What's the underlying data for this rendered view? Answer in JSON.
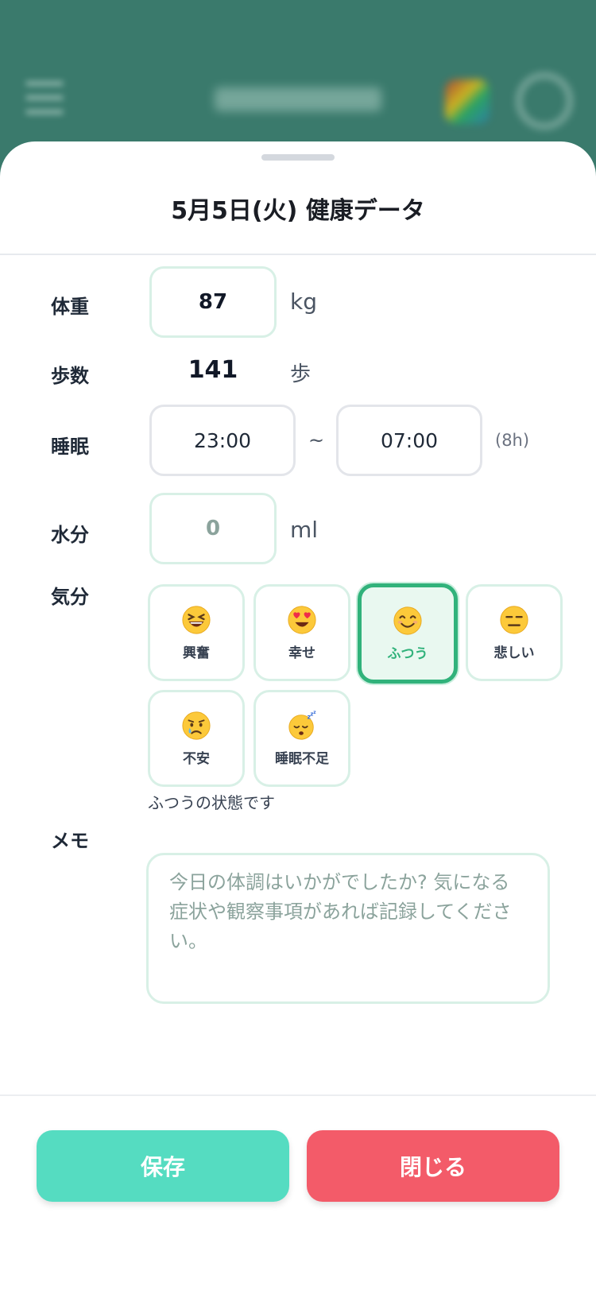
{
  "colors": {
    "accent_green": "#31b27b",
    "save_button": "#55dcc1",
    "close_button": "#f35b69",
    "header_bg": "#3a7a6c"
  },
  "sheet": {
    "title": "5月5日(火) 健康データ"
  },
  "form": {
    "weight": {
      "label": "体重",
      "value": "87",
      "unit": "kg"
    },
    "steps": {
      "label": "歩数",
      "value": "141",
      "unit": "歩"
    },
    "sleep": {
      "label": "睡眠",
      "start": "23:00",
      "separator": "~",
      "end": "07:00",
      "duration": "(8h)"
    },
    "water": {
      "label": "水分",
      "value": "0",
      "unit": "ml"
    },
    "mood": {
      "label": "気分",
      "options": [
        {
          "label": "興奮",
          "icon": "grinning-squint-icon"
        },
        {
          "label": "幸せ",
          "icon": "heart-eyes-icon"
        },
        {
          "label": "ふつう",
          "icon": "smiling-face-icon",
          "selected": true
        },
        {
          "label": "悲しい",
          "icon": "expressionless-icon"
        },
        {
          "label": "不安",
          "icon": "crying-face-icon"
        },
        {
          "label": "睡眠不足",
          "icon": "sleeping-face-icon"
        }
      ],
      "status_text": "ふつうの状態です"
    },
    "memo": {
      "label": "メモ",
      "placeholder": "今日の体調はいかがでしたか? 気になる症状や観察事項があれば記録してください。"
    }
  },
  "buttons": {
    "save": "保存",
    "close": "閉じる"
  }
}
